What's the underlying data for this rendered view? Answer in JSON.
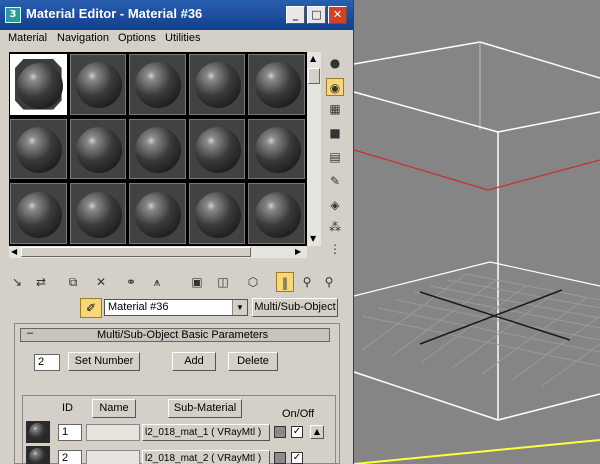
{
  "window": {
    "title": "Material Editor - Material #36",
    "app_icon": "3ds-max-icon",
    "minimize": "_",
    "maximize": "□",
    "close": "✕"
  },
  "menu": [
    "Material",
    "Navigation",
    "Options",
    "Utilities"
  ],
  "slots": {
    "rows": 3,
    "cols": 5,
    "selected_index": 0
  },
  "side_tools": [
    "sample-type-icon",
    "backlight-icon",
    "background-icon",
    "uv-tiling-icon",
    "video-color-check-icon",
    "make-preview-icon",
    "options-icon",
    "select-by-material-icon",
    "material-map-navigator-icon"
  ],
  "bottom_tools": [
    "get-material-icon",
    "put-to-scene-icon",
    "assign-to-selection-icon",
    "reset-map-icon",
    "make-unique-icon",
    "put-to-library-icon",
    "material-effects-channel-icon",
    "show-map-in-viewport-icon",
    "show-end-result-icon",
    "go-to-parent-icon",
    "go-forward-to-sibling-icon"
  ],
  "material_name": "Material #36",
  "material_type": "Multi/Sub-Object",
  "rollout": {
    "minus": "–",
    "title": "Multi/Sub-Object Basic Parameters",
    "number": "2",
    "set_number": "Set Number",
    "add": "Add",
    "delete": "Delete"
  },
  "table": {
    "headers": {
      "id": "ID",
      "name": "Name",
      "sub_material": "Sub-Material",
      "on_off": "On/Off"
    },
    "rows": [
      {
        "id": "1",
        "name": "",
        "sub_material": "l2_018_mat_1  ( VRayMtl )",
        "enabled": "✓"
      },
      {
        "id": "2",
        "name": "",
        "sub_material": "l2_018_mat_2  ( VRayMtl )",
        "enabled": "✓"
      }
    ]
  },
  "colors": {
    "titlebar": "#1a4a9e",
    "panel": "#d4d0c8",
    "viewport": "#858585",
    "wire": "#ffffff",
    "red_line": "#c83030",
    "yellow_line": "#ffff40"
  }
}
